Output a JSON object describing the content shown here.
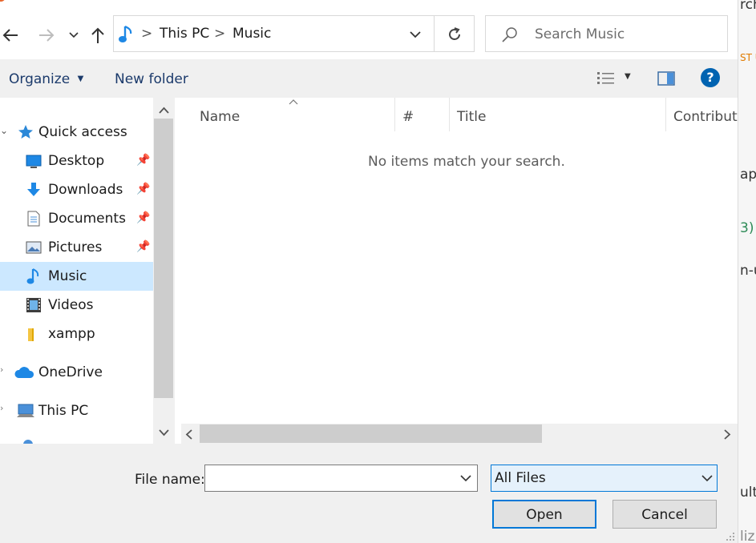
{
  "background_window": {
    "snippets": [
      "rch",
      "ST U",
      "ap",
      "3)",
      "n-u",
      "ult",
      "liz"
    ]
  },
  "navigation": {
    "back_icon": "arrow-left-icon",
    "forward_icon": "arrow-right-icon",
    "recent_icon": "chevron-down-icon",
    "up_icon": "arrow-up-icon"
  },
  "address_bar": {
    "location_icon": "music-note-icon",
    "breadcrumbs": [
      "This PC",
      "Music"
    ],
    "separator": ">"
  },
  "search": {
    "placeholder": "Search Music",
    "icon": "search-icon"
  },
  "toolbar": {
    "organize_label": "Organize",
    "new_folder_label": "New folder",
    "view_icon": "list-view-icon",
    "preview_pane_icon": "preview-pane-icon",
    "help_label": "?"
  },
  "nav_pane": {
    "quick_access": "Quick access",
    "items": [
      {
        "label": "Desktop",
        "icon": "desktop-icon",
        "pinned": true
      },
      {
        "label": "Downloads",
        "icon": "download-icon",
        "pinned": true
      },
      {
        "label": "Documents",
        "icon": "document-icon",
        "pinned": true
      },
      {
        "label": "Pictures",
        "icon": "pictures-icon",
        "pinned": true
      },
      {
        "label": "Music",
        "icon": "music-note-icon",
        "pinned": false,
        "selected": true
      },
      {
        "label": "Videos",
        "icon": "videos-icon",
        "pinned": false
      },
      {
        "label": "xampp",
        "icon": "folder-icon",
        "pinned": false
      }
    ],
    "onedrive": "OneDrive",
    "this_pc": "This PC"
  },
  "file_list": {
    "columns": [
      "Name",
      "#",
      "Title",
      "Contributi"
    ],
    "empty_message": "No items match your search."
  },
  "footer": {
    "file_name_label": "File name:",
    "file_name_value": "",
    "file_type_value": "All Files",
    "open_label": "Open",
    "cancel_label": "Cancel"
  },
  "colors": {
    "selection": "#cce8ff",
    "accent": "#0078d7",
    "help_blue": "#0063b1",
    "chrome": "#f0f0f0"
  }
}
